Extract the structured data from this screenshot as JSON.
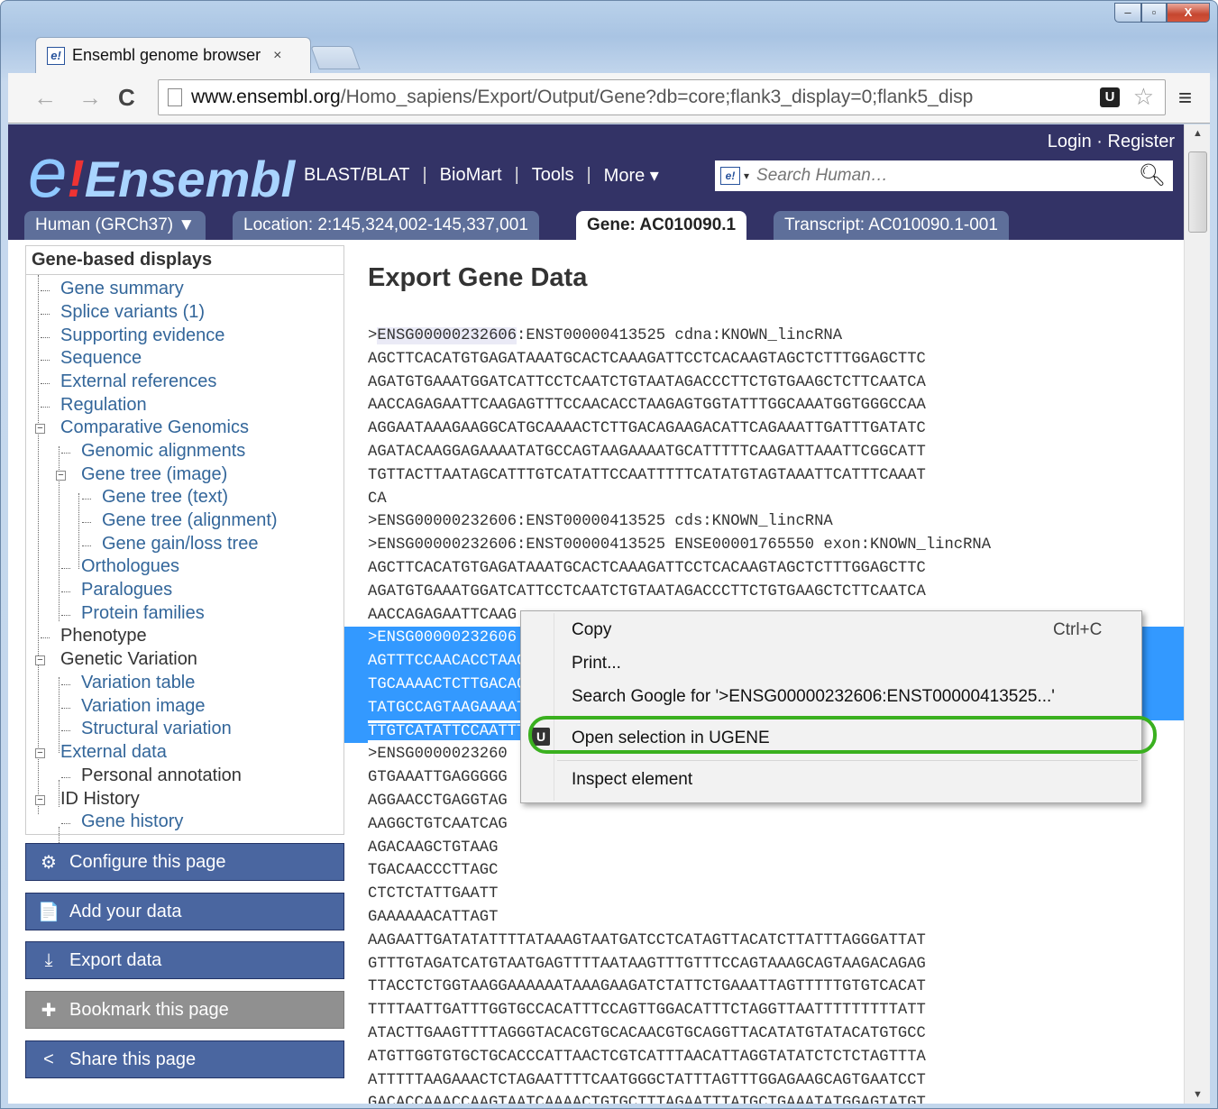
{
  "browser": {
    "tab_title": "Ensembl genome browser",
    "tab_close": "×",
    "url_host": "www.ensembl.org",
    "url_path": "/Homo_sapiens/Export/Output/Gene?db=core;flank3_display=0;flank5_disp",
    "window_controls": {
      "minimize": "–",
      "maximize": "▫",
      "close": "X"
    },
    "nav": {
      "back": "←",
      "forward": "→",
      "reload": "C"
    }
  },
  "header": {
    "logo_e": "e",
    "logo_bang": "!",
    "logo_word": "Ensembl",
    "login": "Login",
    "login_sep": "·",
    "register": "Register",
    "links": [
      "BLAST/BLAT",
      "BioMart",
      "Tools",
      "More ▾"
    ],
    "search_placeholder": "Search Human…"
  },
  "location_tabs": [
    {
      "label": "Human (GRCh37) ▼",
      "active": false
    },
    {
      "label": "Location: 2:145,324,002-145,337,001",
      "active": false
    },
    {
      "label": "Gene: AC010090.1",
      "active": true
    },
    {
      "label": "Transcript: AC010090.1-001",
      "active": false
    }
  ],
  "leftnav": {
    "title": "Gene-based displays",
    "items": [
      "Gene summary",
      "Splice variants (1)",
      "Supporting evidence",
      "Sequence",
      "External references",
      "Regulation",
      "Comparative Genomics",
      "Genomic alignments",
      "Gene tree (image)",
      "Gene tree (text)",
      "Gene tree (alignment)",
      "Gene gain/loss tree",
      "Orthologues",
      "Paralogues",
      "Protein families",
      "Phenotype",
      "Genetic Variation",
      "Variation table",
      "Variation image",
      "Structural variation",
      "External data",
      "Personal annotation",
      "ID History",
      "Gene history"
    ]
  },
  "side_buttons": [
    {
      "label": "Configure this page",
      "icon": "gear-icon",
      "glyph": "⚙"
    },
    {
      "label": "Add your data",
      "icon": "add-data-icon",
      "glyph": "📄"
    },
    {
      "label": "Export data",
      "icon": "export-icon",
      "glyph": "⤓"
    },
    {
      "label": "Bookmark this page",
      "icon": "bookmark-icon",
      "glyph": "✚"
    },
    {
      "label": "Share this page",
      "icon": "share-icon",
      "glyph": "<"
    }
  ],
  "content": {
    "title": "Export Gene Data",
    "lines": [
      ">ENSG00000232606:ENST00000413525 cdna:KNOWN_lincRNA",
      "AGCTTCACATGTGAGATAAATGCACTCAAAGATTCCTCACAAGTAGCTCTTTGGAGCTTC",
      "AGATGTGAAATGGATCATTCCTCAATCTGTAATAGACCCTTCTGTGAAGCTCTTCAATCA",
      "AACCAGAGAATTCAAGAGTTTCCAACACCTAAGAGTGGTATTTGGCAAATGGTGGGCCAA",
      "AGGAATAAAGAAGGCATGCAAAACTCTTGACAGAAGACATTCAGAAATTGATTTGATATC",
      "AGATACAAGGAGAAAATATGCCAGTAAGAAAATGCATTTTTCAAGATTAAATTCGGCATT",
      "TGTTACTTAATAGCATTTGTCATATTCCAATTTTTCATATGTAGTAAATTCATTTCAAAT",
      "CA",
      ">ENSG00000232606:ENST00000413525 cds:KNOWN_lincRNA",
      ">ENSG00000232606:ENST00000413525 ENSE00001765550 exon:KNOWN_lincRNA",
      "AGCTTCACATGTGAGATAAATGCACTCAAAGATTCCTCACAAGTAGCTCTTTGGAGCTTC",
      "AGATGTGAAATGGATCATTCCTCAATCTGTAATAGACCCTTCTGTGAAGCTCTTCAATCA",
      "AACCAGAGAATTCAAG",
      ">ENSG00000232606:ENST00000413525 ENSE00001709530 exon:KNOWN_lincRNA",
      "AGTTTCCAACACCTAAGAGTGGTATTTGGCAAATGGTGGGCCAAAGGAATAAAGAAGGCA",
      "TGCAAAACTCTTGACAGAAGACATTCAGAAATTGATTTGATATCAGATACAAGGAGAAAA",
      "TATGCCAGTAAGAAAATGCATTTTTCAAGATTAAATTCGGCATTTGTTACTTAATAGCAT",
      "TTGTCATATTCCAATTTTTCATATGTAGTAAATTCATTTCAAATCA",
      ">ENSG0000023260",
      "GTGAAATTGAGGGGG",
      "AGGAACCTGAGGTAG",
      "AAGGCTGTCAATCAG",
      "AGACAAGCTGTAAG",
      "TGACAACCCTTAGC",
      "CTCTCTATTGAATT",
      "GAAAAAACATTAGT",
      "AAGAATTGATATATTTTATAAAGTAATGATCCTCATAGTTACATCTTATTTAGGGATTAT",
      "GTTTGTAGATCATGTAATGAGTTTTAATAAGTTTGTTTCCAGTAAAGCAGTAAGACAGAG",
      "TTACCTCTGGTAAGGAAAAAATAAAGAAGATCTATTCTGAAATTAGTTTTTGTGTCACAT",
      "TTTTAATTGATTTGGTGCCACATTTCCAGTTGGACATTTCTAGGTTAATTTTTTTTTATT",
      "ATACTTGAAGTTTTAGGGTACACGTGCACAACGTGCAGGTTACATATGTATACATGTGCC",
      "ATGTTGGTGTGCTGCACCCATTAACTCGTCATTTAACATTAGGTATATCTCTCTAGTTTA",
      "ATTTTTAAGAAACTCTAGAATTTTCAATGGGCTATTTAGTTTGGAGAAGCAGTGAATCCT",
      "GACACCAAACCAAGTAATCAAAACTGTGCTTTAGAATTTATGCTGAAATATGGAGTATGT"
    ]
  },
  "context_menu": {
    "copy": "Copy",
    "copy_shortcut": "Ctrl+C",
    "print": "Print...",
    "search_google": "Search Google for '>ENSG00000232606:ENST00000413525...'",
    "open_ugene": "Open selection in UGENE",
    "inspect": "Inspect element",
    "ugene_glyph": "U"
  }
}
